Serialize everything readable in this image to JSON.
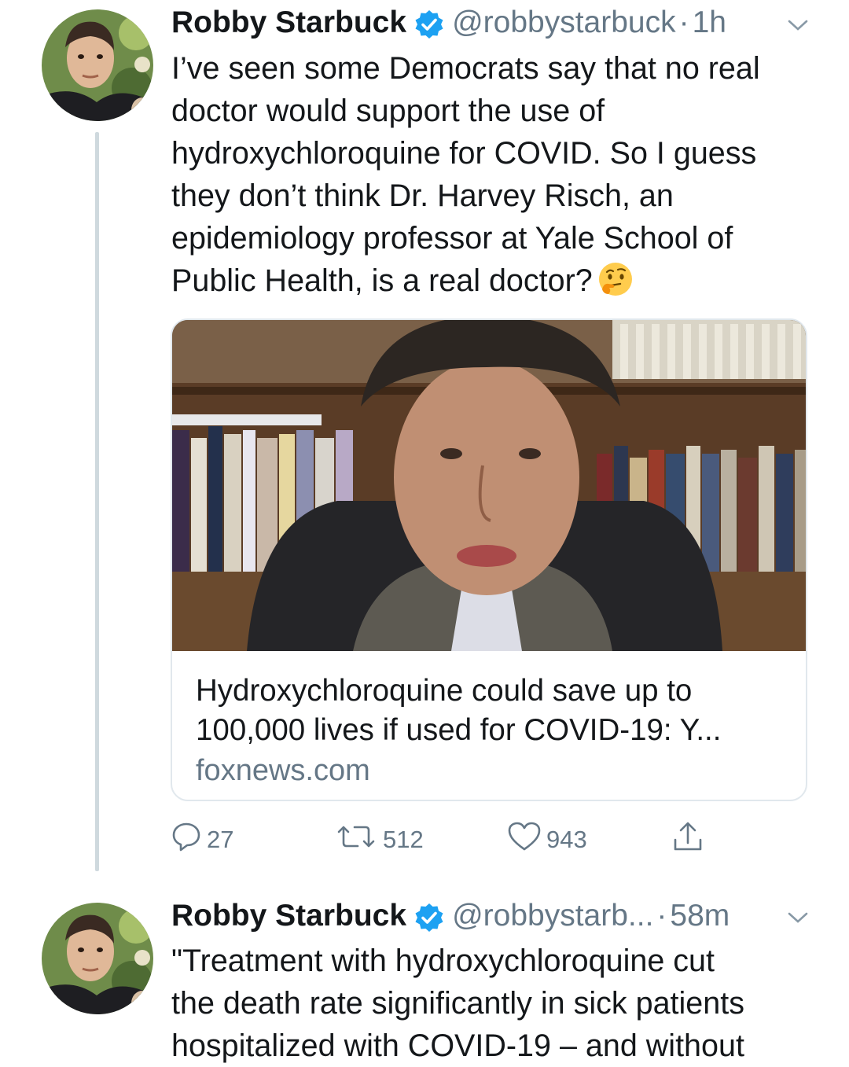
{
  "tweets": [
    {
      "display_name": "Robby Starbuck",
      "handle": "@robbystarbuck",
      "separator": "·",
      "time": "1h",
      "text_lines": [
        "I’ve seen some Democrats say that no real",
        "doctor would support the use of",
        "hydroxychloroquine for COVID. So I guess",
        "they don’t think Dr. Harvey Risch, an",
        "epidemiology professor at Yale School of",
        "Public Health, is a real doctor?"
      ],
      "emoji": "thinking-face",
      "link_card": {
        "title_lines": [
          "Hydroxychloroquine could save up to",
          "100,000 lives if used for COVID-19: Y..."
        ],
        "domain": "foxnews.com"
      },
      "actions": {
        "reply_count": "27",
        "retweet_count": "512",
        "like_count": "943"
      }
    },
    {
      "display_name": "Robby Starbuck",
      "handle": "@robbystarb...",
      "separator": "·",
      "time": "58m",
      "text_lines": [
        "\"Treatment with hydroxychloroquine cut",
        "the death rate significantly in sick patients",
        "hospitalized with COVID-19 – and without"
      ]
    }
  ],
  "colors": {
    "text": "#14171a",
    "secondary": "#657786",
    "verified": "#1da1f2",
    "border": "#e1e8ed"
  }
}
